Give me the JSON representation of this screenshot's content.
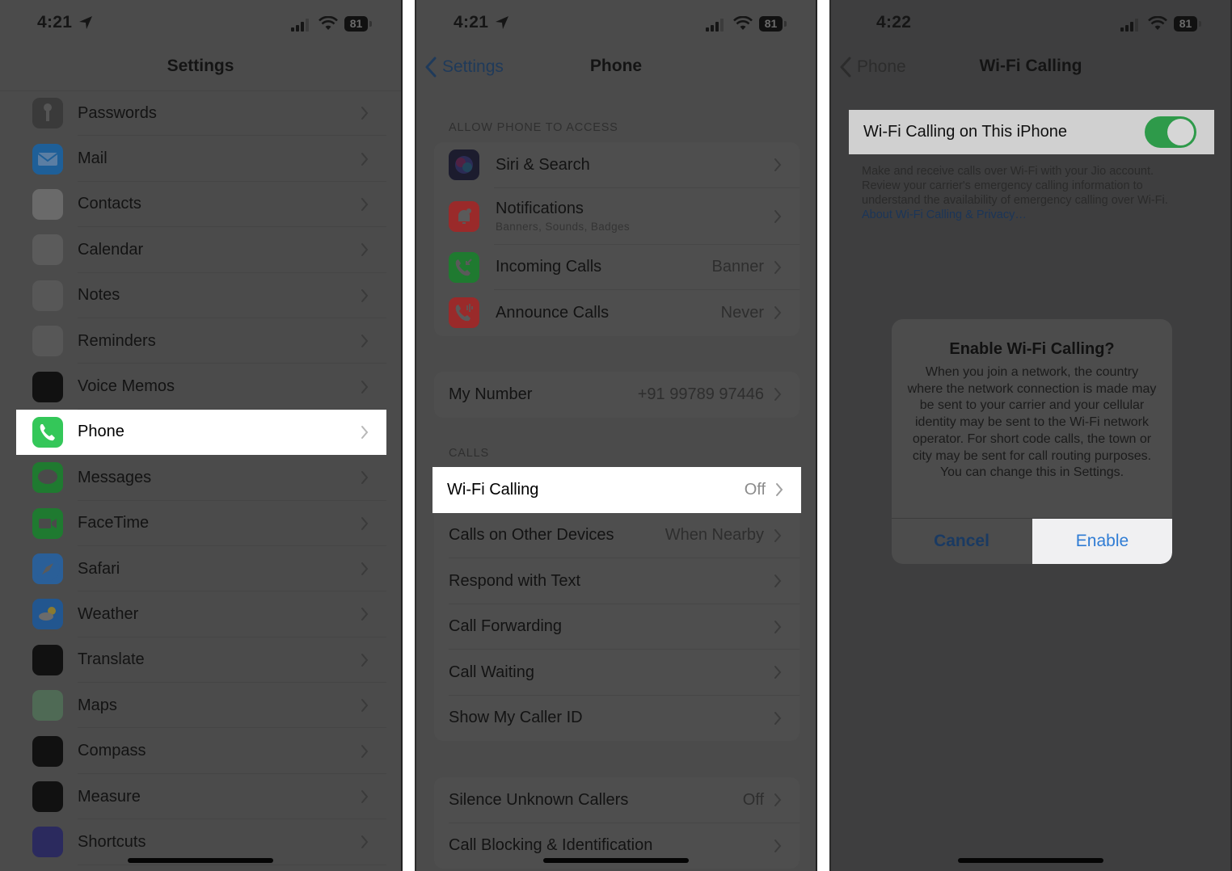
{
  "panel1": {
    "status": {
      "time": "4:21",
      "battery": "81",
      "location_active": true
    },
    "title": "Settings",
    "items": [
      {
        "label": "Passwords",
        "icon": "key-icon",
        "color": "#3a3a3a"
      },
      {
        "label": "Mail",
        "icon": "mail-icon",
        "color": "#1e5f98"
      },
      {
        "label": "Contacts",
        "icon": "contacts-icon",
        "color": "#6a6a6a"
      },
      {
        "label": "Calendar",
        "icon": "calendar-icon",
        "color": "#5b5b5b"
      },
      {
        "label": "Notes",
        "icon": "notes-icon",
        "color": "#575757"
      },
      {
        "label": "Reminders",
        "icon": "reminders-icon",
        "color": "#575757"
      },
      {
        "label": "Voice Memos",
        "icon": "voice-memos-icon",
        "color": "#111111"
      },
      {
        "label": "Phone",
        "icon": "phone-icon",
        "color": "#34c759",
        "highlighted": true
      },
      {
        "label": "Messages",
        "icon": "messages-icon",
        "color": "#1f7a30"
      },
      {
        "label": "FaceTime",
        "icon": "facetime-icon",
        "color": "#1f7a30"
      },
      {
        "label": "Safari",
        "icon": "safari-icon",
        "color": "#2a5f98"
      },
      {
        "label": "Weather",
        "icon": "weather-icon",
        "color": "#22568f"
      },
      {
        "label": "Translate",
        "icon": "translate-icon",
        "color": "#111111"
      },
      {
        "label": "Maps",
        "icon": "maps-icon",
        "color": "#4f6a55"
      },
      {
        "label": "Compass",
        "icon": "compass-icon",
        "color": "#111111"
      },
      {
        "label": "Measure",
        "icon": "measure-icon",
        "color": "#111111"
      },
      {
        "label": "Shortcuts",
        "icon": "shortcuts-icon",
        "color": "#2b2a5e"
      }
    ]
  },
  "panel2": {
    "status": {
      "time": "4:21",
      "battery": "81",
      "location_active": true
    },
    "back_label": "Settings",
    "title": "Phone",
    "section_access": "ALLOW PHONE TO ACCESS",
    "access_items": [
      {
        "label": "Siri & Search",
        "icon": "siri-icon",
        "value": ""
      },
      {
        "label": "Notifications",
        "sublabel": "Banners, Sounds, Badges",
        "icon": "notifications-icon",
        "value": ""
      },
      {
        "label": "Incoming Calls",
        "icon": "incoming-calls-icon",
        "value": "Banner"
      },
      {
        "label": "Announce Calls",
        "icon": "announce-calls-icon",
        "value": "Never"
      }
    ],
    "my_number": {
      "label": "My Number",
      "value": "+91 99789 97446"
    },
    "section_calls": "CALLS",
    "calls_items": [
      {
        "label": "Wi-Fi Calling",
        "value": "Off",
        "highlighted": true
      },
      {
        "label": "Calls on Other Devices",
        "value": "When Nearby"
      },
      {
        "label": "Respond with Text",
        "value": ""
      },
      {
        "label": "Call Forwarding",
        "value": ""
      },
      {
        "label": "Call Waiting",
        "value": ""
      },
      {
        "label": "Show My Caller ID",
        "value": ""
      }
    ],
    "block_items": [
      {
        "label": "Silence Unknown Callers",
        "value": "Off"
      },
      {
        "label": "Call Blocking & Identification",
        "value": ""
      }
    ]
  },
  "panel3": {
    "status": {
      "time": "4:22",
      "battery": "81"
    },
    "back_label": "Phone",
    "title": "Wi-Fi Calling",
    "toggle_label": "Wi-Fi Calling on This iPhone",
    "toggle_on": true,
    "footer": "Make and receive calls over Wi-Fi with your Jio account. Review your carrier's emergency calling information to understand the availability of emergency calling over Wi-Fi.",
    "footer_link": "About Wi-Fi Calling & Privacy…",
    "alert": {
      "title": "Enable Wi-Fi Calling?",
      "message": "When you join a network, the country where the network connection is made may be sent to your carrier and your cellular identity may be sent to the Wi-Fi network operator. For short code calls, the town or city may be sent for call routing purposes. You can change this in Settings.",
      "cancel_label": "Cancel",
      "enable_label": "Enable"
    }
  }
}
